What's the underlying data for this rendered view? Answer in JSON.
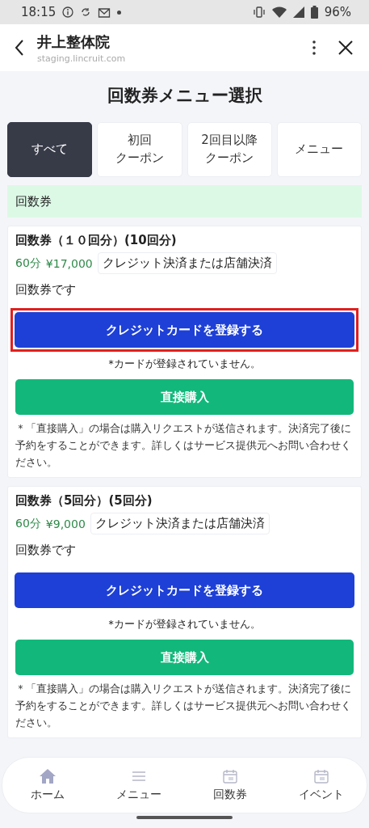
{
  "status_bar": {
    "time": "18:15",
    "battery": "96%"
  },
  "header": {
    "title": "井上整体院",
    "url": "staging.lincruit.com"
  },
  "page_title": "回数券メニュー選択",
  "tabs": [
    {
      "lines": [
        "すべて"
      ],
      "selected": true
    },
    {
      "lines": [
        "初回",
        "クーポン"
      ],
      "selected": false
    },
    {
      "lines": [
        "2回目以降",
        "クーポン"
      ],
      "selected": false
    },
    {
      "lines": [
        "メニュー"
      ],
      "selected": false
    }
  ],
  "section": {
    "title": "回数券"
  },
  "cards": [
    {
      "title": "回数券（１０回分）(10回分)",
      "duration": "60分",
      "price": "¥17,000",
      "payment": "クレジット決済または店舗決済",
      "description": "回数券です",
      "card_button": "クレジットカードを登録する",
      "highlighted": true,
      "card_note": "*カードが登録されていません。",
      "buy_button": "直接購入",
      "notice": "＊「直接購入」の場合は購入リクエストが送信されます。決済完了後に予約をすることができます。詳しくはサービス提供元へお問い合わせください。"
    },
    {
      "title": "回数券（5回分）(5回分)",
      "duration": "60分",
      "price": "¥9,000",
      "payment": "クレジット決済または店舗決済",
      "description": "回数券です",
      "card_button": "クレジットカードを登録する",
      "highlighted": false,
      "card_note": "*カードが登録されていません。",
      "buy_button": "直接購入",
      "notice": "＊「直接購入」の場合は購入リクエストが送信されます。決済完了後に予約をすることができます。詳しくはサービス提供元へお問い合わせください。"
    }
  ],
  "bottom_nav": [
    {
      "kind": "home",
      "label": "ホーム"
    },
    {
      "kind": "menu",
      "label": "メニュー"
    },
    {
      "kind": "calendar",
      "label": "回数券"
    },
    {
      "kind": "calendar",
      "label": "イベント"
    }
  ]
}
